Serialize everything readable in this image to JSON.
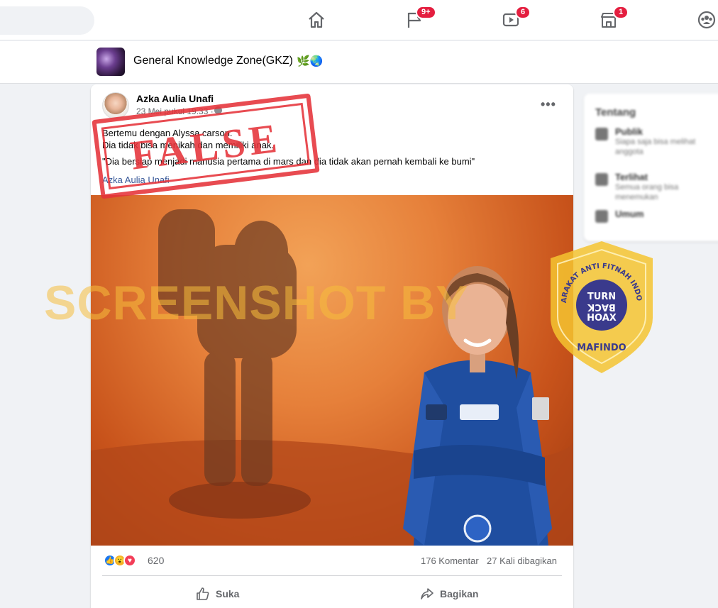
{
  "nav": {
    "badges": {
      "pages": "9+",
      "watch": "6",
      "marketplace": "1"
    }
  },
  "group": {
    "name": "General Knowledge Zone(GKZ)",
    "emoji": "🌿🌏"
  },
  "post": {
    "author": "Azka Aulia Unafi",
    "time": "23 Mei pukul 19.33 ·",
    "text_lines": [
      "Bertemu dengan Alyssa carson.",
      "Dia tidak bisa menikah dan memiliki anak."
    ],
    "quote": "\"Dia bersiap menjadi manusia pertama di mars dan dia tidak akan pernah kembali ke bumi\"",
    "link": "Azka Aulia Unafi",
    "reaction_count": "620",
    "comments": "176 Komentar",
    "shares": "27 Kali dibagikan",
    "like_label": "Suka",
    "share_label": "Bagikan",
    "more_label": "•••"
  },
  "stamp": {
    "text": "FALSE"
  },
  "watermark": {
    "text": "SCREENSHOT BY"
  },
  "badge": {
    "ring_text": "MASYARAKAT ANTI FITNAH INDONESIA",
    "line1": "TURN",
    "line2": "BACK",
    "line3": "HOAX",
    "bottom": "MAFINDO"
  },
  "sidebar": {
    "title": "Tentang",
    "rows": [
      {
        "main": "Publik",
        "sub": "Siapa saja bisa melihat anggota"
      },
      {
        "main": "Terlihat",
        "sub": "Semua orang bisa menemukan"
      },
      {
        "main": "Umum",
        "sub": ""
      }
    ]
  },
  "colors": {
    "accent": "#1877f2",
    "stamp": "#e5333a",
    "badge_yellow": "#f4c430",
    "badge_blue": "#3a3a8c"
  }
}
